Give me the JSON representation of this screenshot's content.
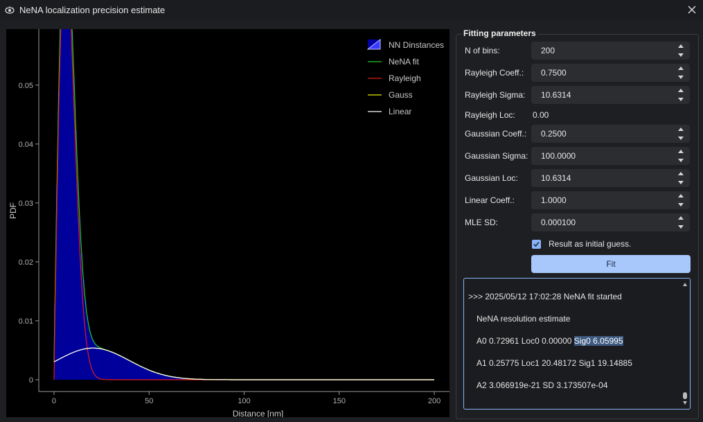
{
  "window": {
    "title": "NeNA localization precision estimate",
    "close_icon": "close-icon",
    "app_icon": "eye-icon"
  },
  "chart_data": {
    "type": "line",
    "xlabel": "Distance [nm]",
    "ylabel": "PDF",
    "xlim": [
      -8,
      208
    ],
    "ylim": [
      -0.002,
      0.0595
    ],
    "xticks": [
      0,
      50,
      100,
      150,
      200
    ],
    "yticks": [
      0,
      0.01,
      0.02,
      0.03,
      0.04,
      0.05
    ],
    "ytick_labels": [
      "0",
      "0.01",
      "0.02",
      "0.03",
      "0.04",
      "0.05"
    ],
    "legend_position": "top-right",
    "legend": [
      {
        "name": "NN Dinstances",
        "color": "#0000a0",
        "kind": "histogram"
      },
      {
        "name": "NeNA fit",
        "color": "#22cc22",
        "kind": "line"
      },
      {
        "name": "Rayleigh",
        "color": "#e01a1a",
        "kind": "line"
      },
      {
        "name": "Gauss",
        "color": "#e8e800",
        "kind": "line"
      },
      {
        "name": "Linear",
        "color": "#ffffff",
        "kind": "line"
      }
    ],
    "params": {
      "A0": 0.72961,
      "Sig0": 6.05995,
      "A1": 0.25775,
      "Loc1": 20.48172,
      "Sig1": 19.14885
    },
    "bins": 200,
    "x_max": 200
  },
  "panel": {
    "group_title": "Fitting parameters",
    "fields": [
      {
        "label": "N of bins:",
        "value": "200"
      },
      {
        "label": "Rayleigh Coeff.:",
        "value": "0.7500"
      },
      {
        "label": "Rayleigh Sigma:",
        "value": "10.6314"
      }
    ],
    "rayleigh_loc": {
      "label": "Rayleigh Loc:",
      "value": "0.00"
    },
    "fields2": [
      {
        "label": "Gaussian Coeff.:",
        "value": "0.2500"
      },
      {
        "label": "Gaussian Sigma:",
        "value": "100.0000"
      },
      {
        "label": "Gaussian Loc:",
        "value": "10.6314"
      },
      {
        "label": "Linear Coeff.:",
        "value": "1.0000"
      },
      {
        "label": "MLE SD:",
        "value": "0.000100"
      }
    ],
    "checkbox_label": "Result as initial guess.",
    "checkbox_checked": true,
    "fit_label": "Fit"
  },
  "log": {
    "line0": ">>> 2025/05/12 17:02:28 NeNA fit started",
    "line1": "NeNA resolution estimate",
    "line2a": "A0 0.72961 Loc0 0.00000 ",
    "line2b": "Sig0 6.05995",
    "line3": "A1 0.25775 Loc1 20.48172 Sig1 19.14885",
    "line4": "A2 3.066919e-21 SD 3.173507e-04"
  }
}
